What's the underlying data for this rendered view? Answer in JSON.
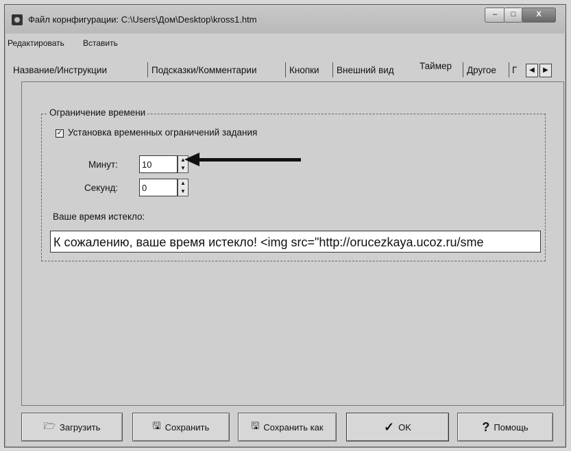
{
  "window": {
    "title": "Файл корнфигурации: C:\\Users\\Дом\\Desktop\\kross1.htm",
    "close_label": "X"
  },
  "menu": {
    "items": [
      {
        "label": "Редактировать"
      },
      {
        "label": "Вставить"
      }
    ]
  },
  "tabs": {
    "items": [
      {
        "label": "Название/Инструкции"
      },
      {
        "label": "Подсказки/Комментарии"
      },
      {
        "label": "Кнопки"
      },
      {
        "label": "Внешний вид"
      },
      {
        "label": "Таймер",
        "active": true
      },
      {
        "label": "Другое"
      },
      {
        "label": "Г"
      }
    ]
  },
  "timer": {
    "group_title": "Ограничение времени",
    "checkbox_label": "Установка временных ограничений задания",
    "checkbox_checked": true,
    "minutes_label": "Минут:",
    "minutes_value": "10",
    "seconds_label": "Секунд:",
    "seconds_value": "0",
    "expired_label": "Ваше время истекло:",
    "expired_message": "К сожалению, ваше время истекло! <img src=\"http://orucezkaya.ucoz.ru/sme"
  },
  "buttons": {
    "load": "Загрузить",
    "save": "Сохранить",
    "save_as": "Сохранить как",
    "ok": "OK",
    "help": "Помощь"
  }
}
